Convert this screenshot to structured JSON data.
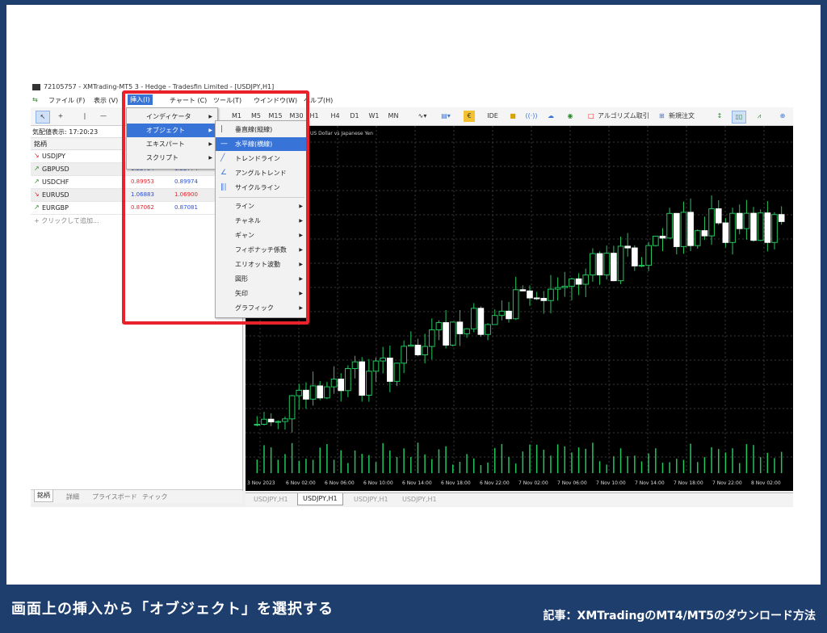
{
  "window": {
    "title": "72105757 - XMTrading-MT5 3 - Hedge - Tradesfin Limited - [USDJPY,H1]"
  },
  "menubar": {
    "items": [
      "ファイル (F)",
      "表示 (V)",
      "挿入(I)",
      "チャート (C)",
      "ツール(T)",
      "ウインドウ(W)",
      "ヘルプ(H)"
    ]
  },
  "toolbar": {
    "timeframes": [
      "M1",
      "M5",
      "M15",
      "M30",
      "H1",
      "H4",
      "D1",
      "W1",
      "MN"
    ],
    "ide_label": "IDE",
    "algo_label": "アルゴリズム取引",
    "new_order_label": "新規注文"
  },
  "market_watch": {
    "header": "気配値表示: 17:20:23",
    "col_symbol": "銘柄",
    "rows": [
      {
        "symbol": "USDJPY",
        "dir": "down",
        "bid": "",
        "ask": ""
      },
      {
        "symbol": "GBPUSD",
        "dir": "up",
        "bid": "1.22754",
        "ask": "1.22774"
      },
      {
        "symbol": "USDCHF",
        "dir": "up",
        "bid": "0.89953",
        "ask": "0.89974"
      },
      {
        "symbol": "EURUSD",
        "dir": "down",
        "bid": "1.06883",
        "ask": "1.06900"
      },
      {
        "symbol": "EURGBP",
        "dir": "up",
        "bid": "0.87062",
        "ask": "0.87081"
      }
    ],
    "add_label": "+ クリックして追加...",
    "tabs": [
      "銘柄",
      "詳細",
      "プライスボード",
      "ティック"
    ]
  },
  "insert_menu": {
    "items": [
      {
        "label": "インディケータ",
        "submenu": true
      },
      {
        "label": "オブジェクト",
        "submenu": true,
        "highlight": true
      },
      {
        "label": "エキスパート",
        "submenu": true
      },
      {
        "label": "スクリプト",
        "submenu": true
      }
    ]
  },
  "object_menu": {
    "items": [
      {
        "label": "垂直線(縦線)",
        "icon": "vertical-line-icon"
      },
      {
        "label": "水平線(横線)",
        "icon": "horizontal-line-icon",
        "highlight": true
      },
      {
        "label": "トレンドライン",
        "icon": "trendline-icon"
      },
      {
        "label": "アングルトレンド",
        "icon": "angle-trend-icon"
      },
      {
        "label": "サイクルライン",
        "icon": "cycle-lines-icon"
      }
    ],
    "sub_items": [
      "ライン",
      "チャネル",
      "ギャン",
      "フィボナッチ係数",
      "エリオット波動",
      "図形",
      "矢印",
      "グラフィック"
    ]
  },
  "chart": {
    "label": "US Dollar vs Japanese Yen",
    "xaxis": [
      "3 Nov 2023",
      "6 Nov 02:00",
      "6 Nov 06:00",
      "6 Nov 10:00",
      "6 Nov 14:00",
      "6 Nov 18:00",
      "6 Nov 22:00",
      "7 Nov 02:00",
      "7 Nov 06:00",
      "7 Nov 10:00",
      "7 Nov 14:00",
      "7 Nov 18:00",
      "7 Nov 22:00",
      "8 Nov 02:00"
    ],
    "tabs": [
      "USDJPY,H1",
      "USDJPY,H1",
      "USDJPY,H1",
      "USDJPY,H1"
    ],
    "bull_color": "#22c55e",
    "bear_color": "#ffffff"
  },
  "captions": {
    "main": "画面上の挿入から「オブジェクト」を選択する",
    "article": "記事：XMTradingのMT4/MT5のダウンロード方法"
  }
}
